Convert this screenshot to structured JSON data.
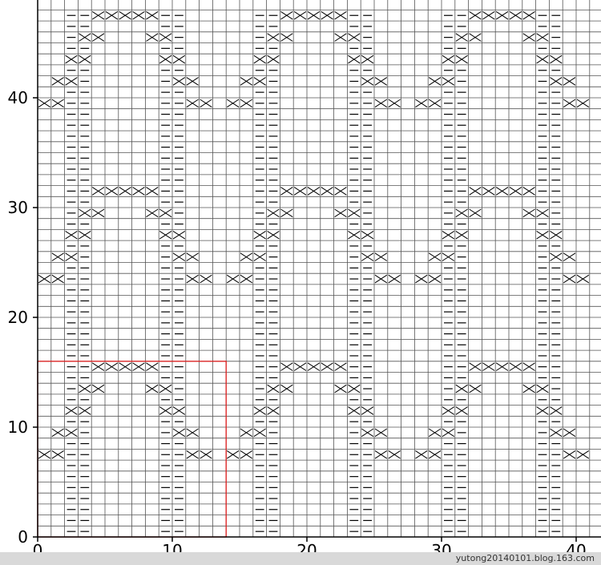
{
  "chart_data": {
    "type": "knitting-chart",
    "x_ticks": [
      0,
      10,
      20,
      30,
      40
    ],
    "y_ticks": [
      0,
      10,
      20,
      30,
      40
    ],
    "xlim": [
      0,
      42
    ],
    "ylim": [
      0,
      40
    ],
    "grid": true,
    "repeat_box": {
      "from_col": 0,
      "to_col": 14,
      "from_row": 0,
      "to_row": 16,
      "color": "#e02020"
    },
    "repeat": {
      "cols": 14,
      "rows": 16
    },
    "symbols": [
      {
        "name": "purl",
        "glyph": "—"
      },
      {
        "name": "cable-cross-left",
        "glyph": "╳"
      },
      {
        "name": "cable-cross-right",
        "glyph": "╳"
      }
    ]
  },
  "watermark": "yutong20140101.blog.163.com"
}
